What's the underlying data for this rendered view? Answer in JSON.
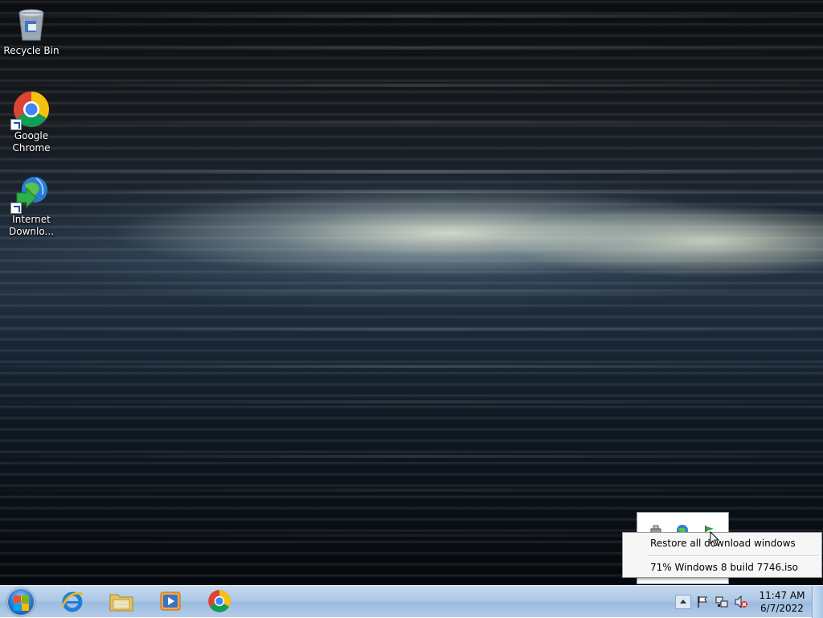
{
  "desktop": {
    "icons": [
      {
        "label": "Recycle Bin",
        "icon": "recycle-bin-icon"
      },
      {
        "label": "Google Chrome",
        "icon": "chrome-icon"
      },
      {
        "label": "Internet Downlo...",
        "icon": "internet-download-manager-icon"
      }
    ]
  },
  "context_menu": {
    "items": [
      {
        "label": "Restore all download windows"
      },
      {
        "label": "71% Windows 8 build 7746.iso"
      }
    ]
  },
  "tray_overflow": {
    "icons": [
      "network-device-icon",
      "idm-globe-icon",
      "green-flag-icon"
    ]
  },
  "taskbar": {
    "start": "windows-start-orb",
    "pinned": [
      {
        "name": "internet-explorer",
        "icon": "ie-icon"
      },
      {
        "name": "windows-explorer",
        "icon": "folder-icon"
      },
      {
        "name": "windows-media-player",
        "icon": "media-player-icon"
      },
      {
        "name": "google-chrome",
        "icon": "chrome-icon"
      }
    ],
    "tray": {
      "icons": [
        "show-hidden-icons-arrow",
        "action-center-flag-icon",
        "network-icon",
        "volume-muted-icon"
      ],
      "time": "11:47 AM",
      "date": "6/7/2022"
    }
  },
  "colors": {
    "taskbar": "#aec8e6",
    "menu_bg": "#f6f6f6",
    "chrome_red": "#db4437",
    "chrome_yellow": "#f4c20d",
    "chrome_green": "#0f9d58",
    "chrome_blue": "#4285f4"
  }
}
